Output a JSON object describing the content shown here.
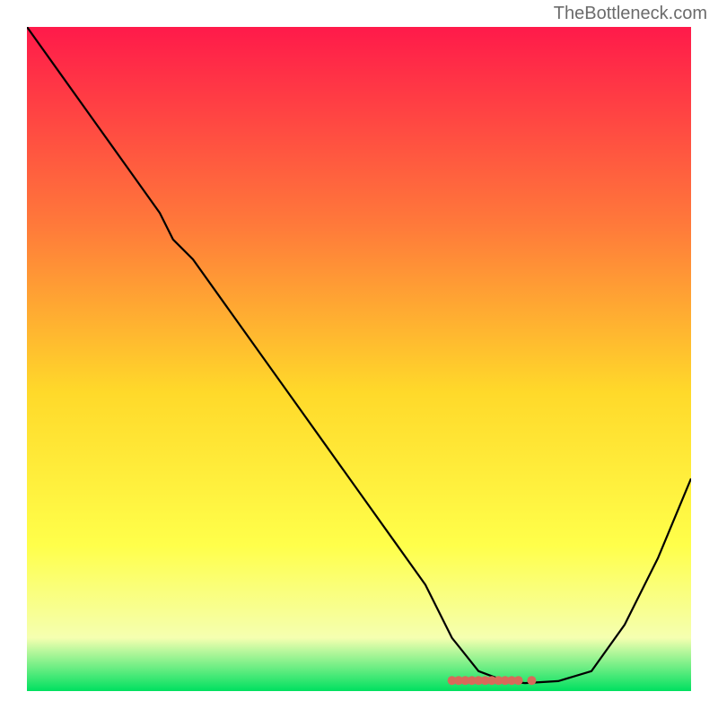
{
  "watermark": "TheBottleneck.com",
  "chart_data": {
    "type": "line",
    "title": "",
    "xlabel": "",
    "ylabel": "",
    "xlim": [
      0,
      100
    ],
    "ylim": [
      0,
      100
    ],
    "gradient_colors": {
      "top": "#ff1a4a",
      "mid_upper": "#ff7a3a",
      "mid": "#ffd92a",
      "mid_lower": "#ffff4a",
      "lower": "#f5ffb0",
      "bottom": "#00e060"
    },
    "series": [
      {
        "name": "bottleneck-curve",
        "type": "line",
        "color": "#000000",
        "x": [
          0,
          5,
          10,
          15,
          20,
          22,
          25,
          30,
          35,
          40,
          45,
          50,
          55,
          60,
          64,
          68,
          72,
          75,
          80,
          85,
          90,
          95,
          100
        ],
        "y": [
          100,
          93,
          86,
          79,
          72,
          68,
          65,
          58,
          51,
          44,
          37,
          30,
          23,
          16,
          8,
          3,
          1.5,
          1.2,
          1.5,
          3,
          10,
          20,
          32
        ]
      },
      {
        "name": "optimal-marker",
        "type": "marker",
        "color": "#d86a5a",
        "x": [
          64,
          65,
          66,
          67,
          68,
          69,
          70,
          71,
          72,
          73,
          74,
          76
        ],
        "y": [
          1.6,
          1.6,
          1.6,
          1.6,
          1.6,
          1.6,
          1.6,
          1.6,
          1.6,
          1.6,
          1.6,
          1.6
        ]
      }
    ]
  }
}
